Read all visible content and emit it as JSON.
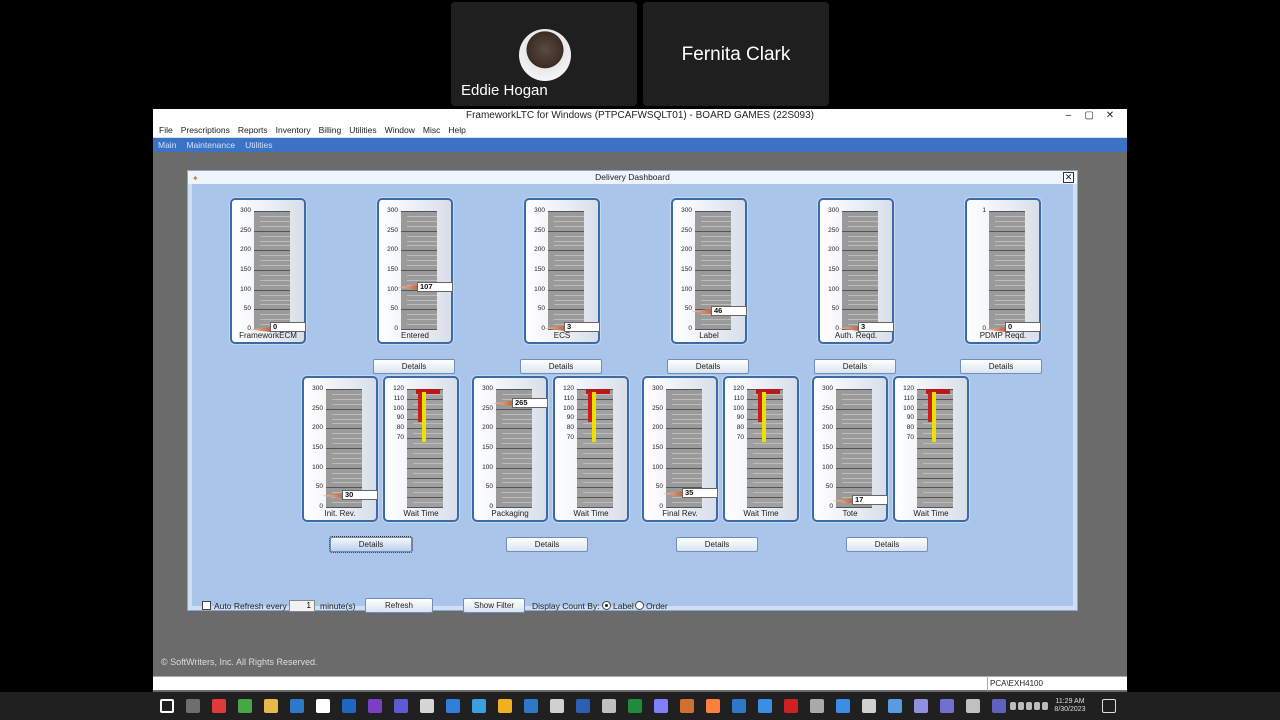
{
  "participants": [
    {
      "name": "Eddie Hogan"
    },
    {
      "name": "Fernita Clark"
    }
  ],
  "window": {
    "title": "FrameworkLTC for Windows (PTPCAFWSQLT01) - BOARD GAMES (22S093)",
    "controls": [
      "–",
      "▢",
      "✕"
    ]
  },
  "menu": [
    "File",
    "Prescriptions",
    "Reports",
    "Inventory",
    "Billing",
    "Utilities",
    "Window",
    "Misc",
    "Help"
  ],
  "nav": [
    "Main",
    "Maintenance",
    "Utilities"
  ],
  "dashboard": {
    "title": "Delivery Dashboard",
    "close": "✕",
    "top_gauges": [
      {
        "label": "FrameworkECM",
        "value": "0",
        "scale": [
          "300",
          "250",
          "200",
          "150",
          "100",
          "50",
          "0"
        ]
      },
      {
        "label": "Entered",
        "value": "107",
        "scale": [
          "300",
          "250",
          "200",
          "150",
          "100",
          "50",
          "0"
        ]
      },
      {
        "label": "ECS",
        "value": "3",
        "scale": [
          "300",
          "250",
          "200",
          "150",
          "100",
          "50",
          "0"
        ]
      },
      {
        "label": "Label",
        "value": "46",
        "scale": [
          "300",
          "250",
          "200",
          "150",
          "100",
          "50",
          "0"
        ]
      },
      {
        "label": "Auth. Reqd.",
        "value": "3",
        "scale": [
          "300",
          "250",
          "200",
          "150",
          "100",
          "50",
          "0"
        ]
      },
      {
        "label": "PDMP Reqd.",
        "value": "0",
        "scale": [
          "1",
          "0"
        ]
      }
    ],
    "bottom_groups": [
      {
        "count_label": "Init. Rev.",
        "value": "30",
        "wait_label": "Wait Time"
      },
      {
        "count_label": "Packaging",
        "value": "265",
        "wait_label": "Wait Time"
      },
      {
        "count_label": "Final Rev.",
        "value": "35",
        "wait_label": "Wait Time"
      },
      {
        "count_label": "Tote",
        "value": "17",
        "wait_label": "Wait Time"
      }
    ],
    "count_scale": [
      "300",
      "250",
      "200",
      "150",
      "100",
      "50",
      "0"
    ],
    "wait_scale": [
      "120",
      "110",
      "100",
      "90",
      "80",
      "70"
    ],
    "details_label": "Details",
    "auto_refresh_label": "Auto Refresh every",
    "refresh_minutes": "1",
    "minutes_label": "minute(s)",
    "refresh_button": "Refresh",
    "show_filter_button": "Show Filter",
    "display_count_label": "Display Count By:",
    "radio_label": "Label",
    "radio_order": "Order"
  },
  "copyright": "© SoftWriters, Inc. All Rights Reserved.",
  "status_cell": "PCA\\EXH4100",
  "clock": {
    "time": "11:29 AM",
    "date": "8/30/2023"
  }
}
